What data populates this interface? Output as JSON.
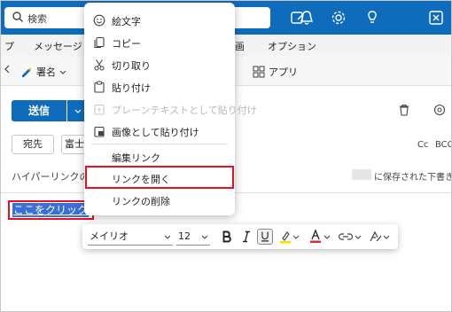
{
  "search": {
    "placeholder": "検索"
  },
  "ribbon": {
    "tab_left_fragment": "プ",
    "tab_message": "メッセージ",
    "tab_partial": "画",
    "tab_options": "オプション"
  },
  "toolbar": {
    "signature": "署名",
    "apps": "アプリ"
  },
  "compose": {
    "send": "送信",
    "to": "宛先",
    "to_value": "富士",
    "cc": "Cc",
    "bcc": "BCC",
    "subject_partial": "ハイパーリンクの作成",
    "saved_draft": "に保存された下書き",
    "link_text": "ここをクリック"
  },
  "context_menu": {
    "items": [
      {
        "label": "絵文字",
        "icon": "emoji-icon",
        "enabled": true
      },
      {
        "label": "コピー",
        "icon": "copy-icon",
        "enabled": true
      },
      {
        "label": "切り取り",
        "icon": "cut-icon",
        "enabled": true
      },
      {
        "label": "貼り付け",
        "icon": "paste-icon",
        "enabled": true
      },
      {
        "label": "プレーンテキストとして貼り付け",
        "icon": "paste-text-icon",
        "enabled": false
      },
      {
        "label": "画像として貼り付け",
        "icon": "paste-image-icon",
        "enabled": true
      },
      {
        "label": "編集リンク",
        "icon": "",
        "enabled": true
      },
      {
        "label": "リンクを開く",
        "icon": "",
        "enabled": true,
        "highlighted": true
      },
      {
        "label": "リンクの削除",
        "icon": "",
        "enabled": true
      }
    ]
  },
  "format_bar": {
    "font": "メイリオ",
    "size": "12"
  },
  "colors": {
    "brand": "#0f6cbd",
    "highlight_box": "#e81123",
    "link_selection": "#3b6fd4"
  }
}
